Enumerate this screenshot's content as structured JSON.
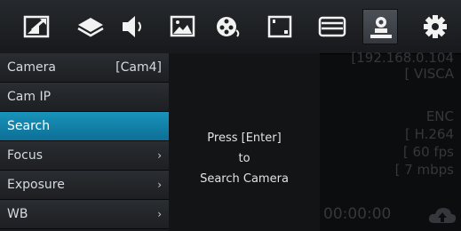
{
  "toolbar": {
    "icons": [
      "picture-in-picture-icon",
      "layers-icon",
      "speaker-icon",
      "image-icon",
      "film-reel-icon",
      "storage-card-icon",
      "video-menu-icon",
      "camera-network-icon",
      "gear-icon"
    ],
    "active_icon": "camera-network-icon"
  },
  "menu": {
    "items": [
      {
        "label": "Camera",
        "value": "[Cam4]",
        "has_submenu": false,
        "selected": false
      },
      {
        "label": "Cam IP",
        "value": "",
        "has_submenu": false,
        "selected": false
      },
      {
        "label": "Search",
        "value": "",
        "has_submenu": false,
        "selected": true
      },
      {
        "label": "Focus",
        "value": "",
        "has_submenu": true,
        "selected": false
      },
      {
        "label": "Exposure",
        "value": "",
        "has_submenu": true,
        "selected": false
      },
      {
        "label": "WB",
        "value": "",
        "has_submenu": true,
        "selected": false
      }
    ],
    "chevron": "›"
  },
  "center": {
    "line1": "Press [Enter]",
    "line2": "to",
    "line3": "Search Camera"
  },
  "status": {
    "ip": "[192.168.0.104",
    "protocol": "[ VISCA",
    "enc": "ENC",
    "codec": "[ H.264",
    "fps": "[ 60 fps",
    "bitrate": "[ 7 mbps",
    "timer": "00:00:00"
  },
  "colors": {
    "selected": "#1282ad",
    "status_dim": "#34383d"
  }
}
